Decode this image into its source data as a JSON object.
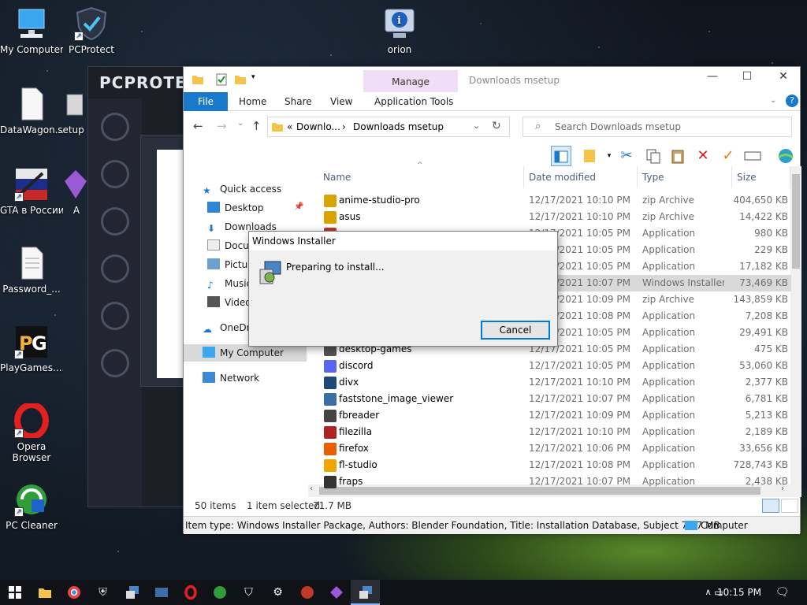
{
  "desktop": {
    "icons": [
      {
        "label": "My Computer"
      },
      {
        "label": "PCProtect"
      },
      {
        "label": "orion"
      },
      {
        "label": "DataWagon..."
      },
      {
        "label": "setup"
      },
      {
        "label": "GTA в России"
      },
      {
        "label": "A"
      },
      {
        "label": "Password_..."
      },
      {
        "label": "PlayGames...."
      },
      {
        "label": "Opera"
      },
      {
        "label": "Browser"
      },
      {
        "label": "PC Cleaner"
      }
    ]
  },
  "pcprotect": {
    "title": "PCPROTEC"
  },
  "explorer": {
    "window_title": "Downloads msetup",
    "context_tab": "Manage",
    "tabs": {
      "file": "File",
      "home": "Home",
      "share": "Share",
      "view": "View",
      "app_tools": "Application Tools"
    },
    "address": {
      "prefix": "«",
      "part1": "Downlo...",
      "sep": "›",
      "part2": "Downloads msetup"
    },
    "search": {
      "placeholder": "Search Downloads msetup"
    },
    "columns": {
      "name": "Name",
      "date": "Date modified",
      "type": "Type",
      "size": "Size"
    },
    "nav": {
      "quick_access": "Quick access",
      "desktop": "Desktop",
      "downloads": "Downloads",
      "documents": "Docun",
      "pictures": "Pictur",
      "music": "Music",
      "videos": "Video",
      "onedrive": "OneDriv",
      "my_computer": "My Computer",
      "network": "Network"
    },
    "files": [
      {
        "name": "anime-studio-pro",
        "date": "12/17/2021 10:10 PM",
        "type": "zip Archive",
        "size": "404,650 KB",
        "color": "#d9a400"
      },
      {
        "name": "asus",
        "date": "12/17/2021 10:10 PM",
        "type": "zip Archive",
        "size": "14,422 KB",
        "color": "#d9a400"
      },
      {
        "name": "",
        "date": "12/17/2021 10:05 PM",
        "type": "Application",
        "size": "980 KB",
        "color": "#c0392b"
      },
      {
        "name": "",
        "date": "12/17/2021 10:05 PM",
        "type": "Application",
        "size": "229 KB",
        "color": "#2e7bd6"
      },
      {
        "name": "",
        "date": "12/17/2021 10:05 PM",
        "type": "Application",
        "size": "17,182 KB",
        "color": "#2e7bd6"
      },
      {
        "name": "",
        "date": "12/17/2021 10:07 PM",
        "type": "Windows Installer ...",
        "size": "73,469 KB",
        "color": "#5b8fd0"
      },
      {
        "name": "",
        "date": "12/17/2021 10:09 PM",
        "type": "zip Archive",
        "size": "143,859 KB",
        "color": "#d9a400"
      },
      {
        "name": "",
        "date": "12/17/2021 10:08 PM",
        "type": "Application",
        "size": "7,208 KB",
        "color": "#2e7bd6"
      },
      {
        "name": "",
        "date": "12/17/2021 10:05 PM",
        "type": "Application",
        "size": "29,491 KB",
        "color": "#2e7bd6"
      },
      {
        "name": "desktop-games",
        "date": "12/17/2021 10:05 PM",
        "type": "Application",
        "size": "475 KB",
        "color": "#555"
      },
      {
        "name": "discord",
        "date": "12/17/2021 10:05 PM",
        "type": "Application",
        "size": "53,060 KB",
        "color": "#5865f2"
      },
      {
        "name": "divx",
        "date": "12/17/2021 10:10 PM",
        "type": "Application",
        "size": "2,377 KB",
        "color": "#1b4a7a"
      },
      {
        "name": "faststone_image_viewer",
        "date": "12/17/2021 10:07 PM",
        "type": "Application",
        "size": "6,781 KB",
        "color": "#3b6ea5"
      },
      {
        "name": "fbreader",
        "date": "12/17/2021 10:09 PM",
        "type": "Application",
        "size": "5,213 KB",
        "color": "#444"
      },
      {
        "name": "filezilla",
        "date": "12/17/2021 10:10 PM",
        "type": "Application",
        "size": "2,189 KB",
        "color": "#b22222"
      },
      {
        "name": "firefox",
        "date": "12/17/2021 10:06 PM",
        "type": "Application",
        "size": "33,656 KB",
        "color": "#e66000"
      },
      {
        "name": "fl-studio",
        "date": "12/17/2021 10:08 PM",
        "type": "Application",
        "size": "728,743 KB",
        "color": "#f0a500"
      },
      {
        "name": "fraps",
        "date": "12/17/2021 10:07 PM",
        "type": "Application",
        "size": "2,438 KB",
        "color": "#333"
      }
    ],
    "status": {
      "count": "50 items",
      "selected": "1 item selected",
      "sel_size": "71.7 MB"
    },
    "details": {
      "text": "Item type: Windows Installer Package, Authors: Blender Foundation, Title: Installation Database, Subject  71.7 MB",
      "location": "Computer"
    }
  },
  "dialog": {
    "title": "Windows Installer",
    "message": "Preparing to install...",
    "cancel": "Cancel"
  },
  "taskbar": {
    "time": "10:15 PM"
  }
}
